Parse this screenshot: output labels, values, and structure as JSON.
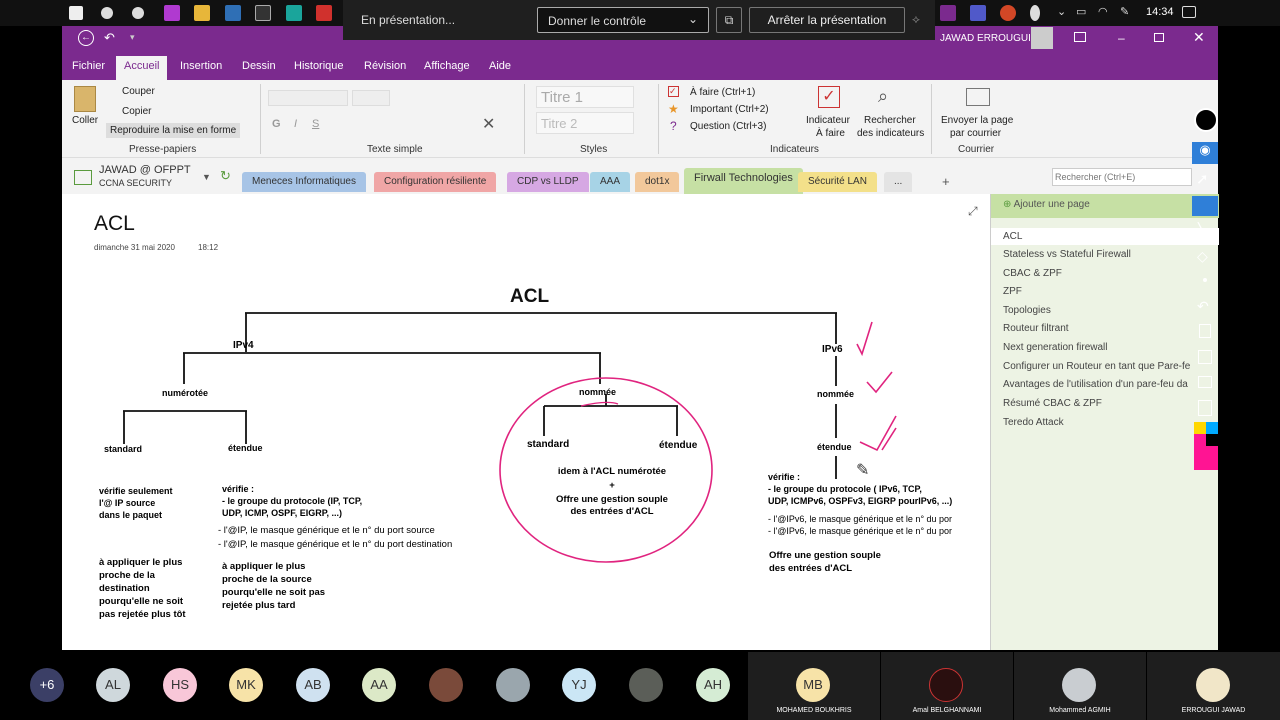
{
  "presentation": {
    "status": "En présentation...",
    "control": "Donner le contrôle",
    "stop": "Arrêter la présentation"
  },
  "clock": "14:34",
  "app": {
    "user": "JAWAD ERROUGUI"
  },
  "ribbon_tabs": [
    "Fichier",
    "Accueil",
    "Insertion",
    "Dessin",
    "Historique",
    "Révision",
    "Affichage",
    "Aide"
  ],
  "ribbon": {
    "clipboard": {
      "paste": "Coller",
      "cut": "Couper",
      "copy": "Copier",
      "format": "Reproduire la mise en forme",
      "group": "Presse-papiers"
    },
    "text_group": "Texte simple",
    "styles": {
      "t1": "Titre 1",
      "t2": "Titre 2",
      "group": "Styles"
    },
    "tags": {
      "todo": "À faire (Ctrl+1)",
      "important": "Important (Ctrl+2)",
      "question": "Question (Ctrl+3)",
      "tag_todo": "Indicateur",
      "tag_todo2": "À faire",
      "find": "Rechercher",
      "find2": "des indicateurs",
      "group": "Indicateurs"
    },
    "mail": {
      "send": "Envoyer la page",
      "send2": "par courrier",
      "group": "Courrier"
    }
  },
  "notebook": {
    "name": "JAWAD @ OFPPT",
    "section": "CCNA SECURITY"
  },
  "sections": [
    "Meneces Informatiques",
    "Configuration résiliente",
    "CDP vs LLDP",
    "AAA",
    "dot1x",
    "Firwall Technologies",
    "Sécurité LAN",
    "..."
  ],
  "search_placeholder": "Rechercher (Ctrl+E)",
  "page": {
    "title": "ACL",
    "date": "dimanche 31 mai 2020",
    "time": "18:12"
  },
  "pages_panel": {
    "add": "Ajouter une page",
    "items": [
      "ACL",
      "Stateless vs Stateful Firewall",
      "CBAC & ZPF",
      "ZPF",
      "Topologies",
      "Routeur filtrant",
      "Next generation firewall",
      "Configurer un Routeur en tant que Pare-fe",
      "Avantages de l'utilisation d'un pare-feu da",
      "Résumé CBAC & ZPF",
      "Teredo Attack"
    ]
  },
  "diagram": {
    "root": "ACL",
    "ipv4": "IPv4",
    "ipv6": "IPv6",
    "numbered": "numérotée",
    "named": "nommée",
    "named6": "nommée",
    "standard": "standard",
    "extended": "étendue",
    "standard2": "standard",
    "extended2": "étendue",
    "extended6": "étendue",
    "std_desc": [
      "vérifie seulement",
      "l'@ IP source",
      "dans le paquet"
    ],
    "ext_desc": [
      "vérifie :",
      "- le groupe du protocole (IP, TCP,",
      "UDP, ICMP, OSPF, EIGRP, ...)",
      "- l'@IP, le masque générique et le n° du port source",
      "- l'@IP, le masque générique et le n° du port destination"
    ],
    "std_apply": [
      "à appliquer le plus",
      "proche de la",
      "destination",
      "pourqu'elle ne soit",
      "pas rejetée plus tôt"
    ],
    "ext_apply": [
      "à appliquer le plus",
      "proche de la source",
      "pourqu'elle ne soit pas",
      "rejetée plus tard"
    ],
    "named_desc": [
      "idem à l'ACL numérotée",
      "+",
      "Offre une gestion souple",
      "des entrées d'ACL"
    ],
    "v6_desc": [
      "vérifie :",
      "- le groupe du protocole (  IPv6, TCP,",
      "UDP, ICMPv6, OSPFv3, EIGRP pourIPv6, ...)",
      "- l'@IPv6, le masque générique et le n° du por",
      "- l'@IPv6, le masque générique et le n° du por"
    ],
    "v6_offer": [
      "Offre une gestion souple",
      "des entrées d'ACL"
    ]
  },
  "participants": {
    "more": "+6",
    "avatars": [
      "AL",
      "HS",
      "MK",
      "AB",
      "AA",
      "",
      "",
      "YJ",
      "",
      "AH"
    ],
    "tiles": [
      {
        "initials": "MB",
        "name": "MOHAMED BOUKHRIS"
      },
      {
        "initials": "",
        "name": "Amal BELGHANNAMI"
      },
      {
        "initials": "",
        "name": "Mohammed AGMIH"
      },
      {
        "initials": "",
        "name": "ERROUGUI JAWAD"
      }
    ]
  }
}
